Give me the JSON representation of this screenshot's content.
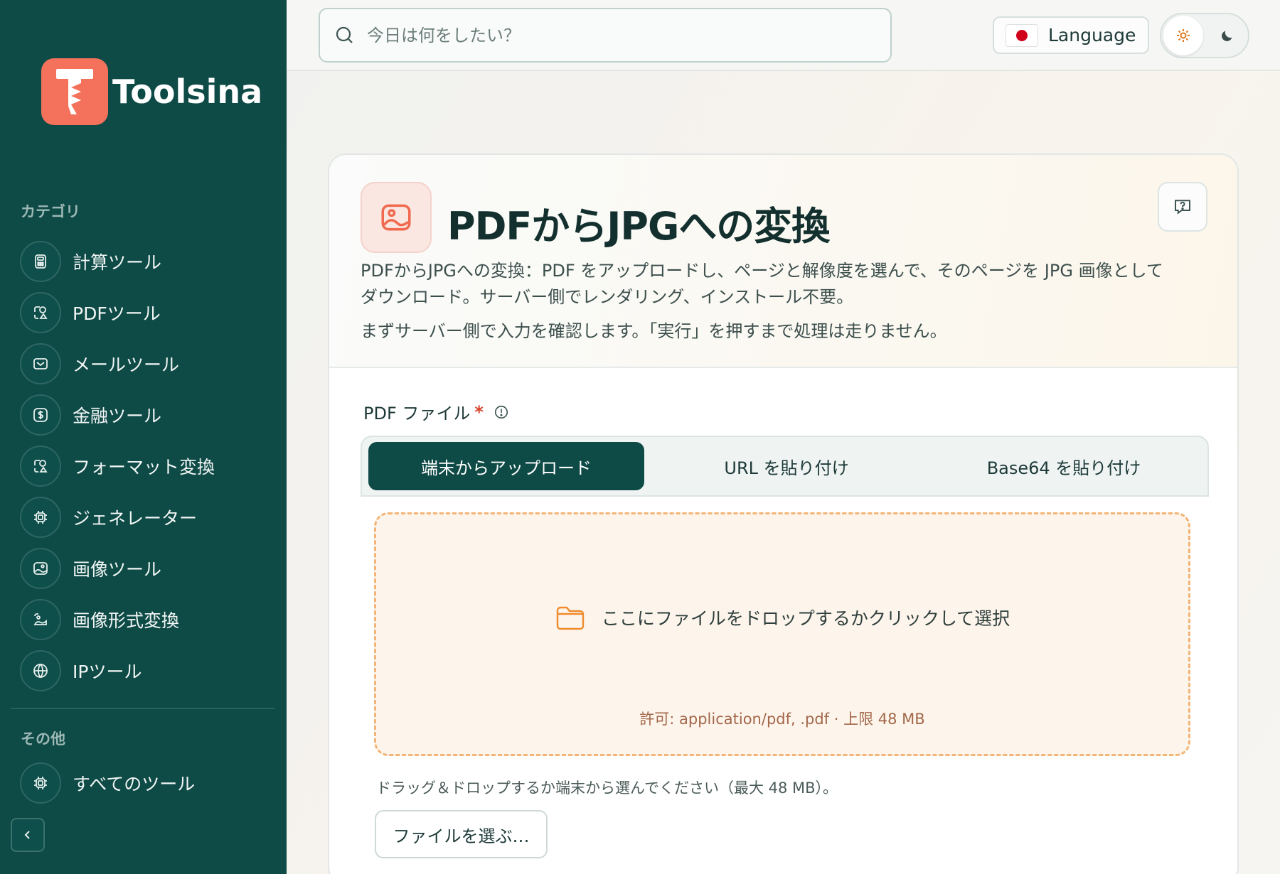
{
  "app": {
    "name": "Toolsina"
  },
  "sidebar": {
    "category_label": "カテゴリ",
    "items": [
      {
        "label": "計算ツール",
        "icon": "calculator-icon"
      },
      {
        "label": "PDFツール",
        "icon": "pdf-shapes-icon"
      },
      {
        "label": "メールツール",
        "icon": "mail-icon"
      },
      {
        "label": "金融ツール",
        "icon": "dollar-icon"
      },
      {
        "label": "フォーマット変換",
        "icon": "format-shapes-icon"
      },
      {
        "label": "ジェネレーター",
        "icon": "chip-icon"
      },
      {
        "label": "画像ツール",
        "icon": "image-icon"
      },
      {
        "label": "画像形式変換",
        "icon": "image-convert-icon"
      },
      {
        "label": "IPツール",
        "icon": "globe-icon"
      }
    ],
    "other_label": "その他",
    "other_items": [
      {
        "label": "すべてのツール",
        "icon": "chip-icon"
      }
    ]
  },
  "topbar": {
    "search_placeholder": "今日は何をしたい？",
    "language_label": "Language"
  },
  "tool": {
    "title": "PDFからJPGへの変換",
    "description": "PDFからJPGへの変換：PDF をアップロードし、ページと解像度を選んで、そのページを JPG 画像としてダウンロード。サーバー側でレンダリング、インストール不要。",
    "note": "まずサーバー側で入力を確認します。「実行」を押すまで処理は走りません。",
    "field_label": "PDF ファイル",
    "required_mark": "*",
    "tabs": [
      "端末からアップロード",
      "URL を貼り付け",
      "Base64 を貼り付け"
    ],
    "drop_text": "ここにファイルをドロップするかクリックして選択",
    "drop_note": "許可: application/pdf, .pdf · 上限 48 MB",
    "hint": "ドラッグ＆ドロップするか端末から選んでください（最大 48 MB）。",
    "choose_button": "ファイルを選ぶ…"
  },
  "colors": {
    "sidebar_bg": "#0e4a46",
    "brand_accent": "#f4725b",
    "active_tab": "#0e4a46",
    "dropzone_border": "#f3b476"
  }
}
